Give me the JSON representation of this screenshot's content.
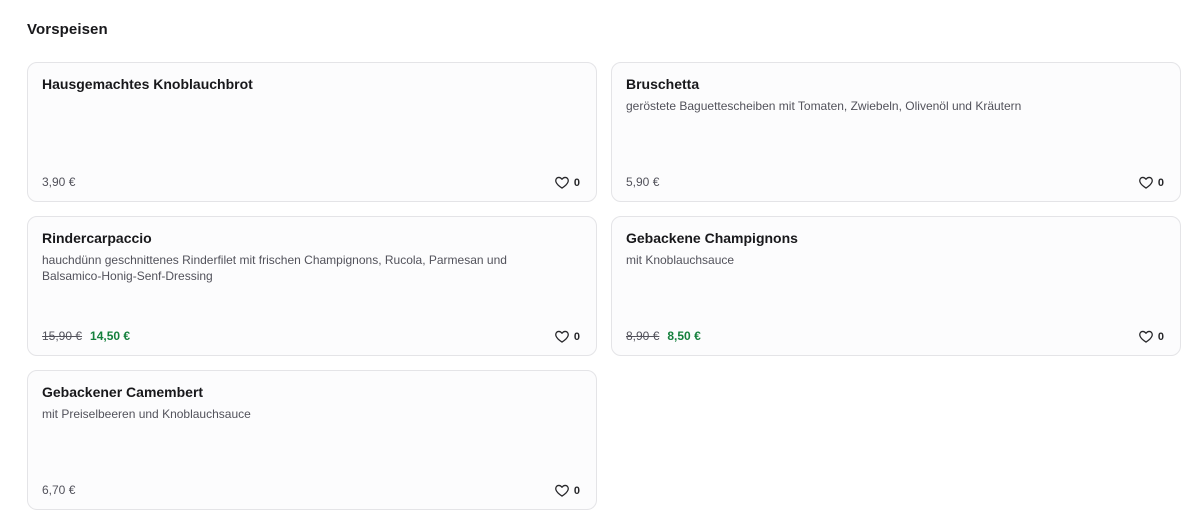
{
  "section": {
    "title": "Vorspeisen"
  },
  "items": [
    {
      "name": "Hausgemachtes Knoblauchbrot",
      "description": "",
      "price": "3,90 €",
      "likes": "0"
    },
    {
      "name": "Bruschetta",
      "description": "geröstete Baguettescheiben mit Tomaten, Zwiebeln, Olivenöl und Kräutern",
      "price": "5,90 €",
      "likes": "0"
    },
    {
      "name": "Rindercarpaccio",
      "description": "hauchdünn geschnittenes Rinderfilet mit frischen Champignons, Rucola, Parmesan und Balsamico-Honig-Senf-Dressing",
      "old_price": "15,90 €",
      "sale_price": "14,50 €",
      "likes": "0"
    },
    {
      "name": "Gebackene Champignons",
      "description": "mit Knoblauchsauce",
      "old_price": "8,90 €",
      "sale_price": "8,50 €",
      "likes": "0"
    },
    {
      "name": "Gebackener Camembert",
      "description": "mit Preiselbeeren und Knoblauchsauce",
      "price": "6,70 €",
      "likes": "0"
    }
  ],
  "icons": {
    "like": "heart-outline-icon"
  },
  "colors": {
    "sale_price": "#15803d",
    "card_border": "#e4e4e7",
    "muted_text": "#52525b"
  }
}
